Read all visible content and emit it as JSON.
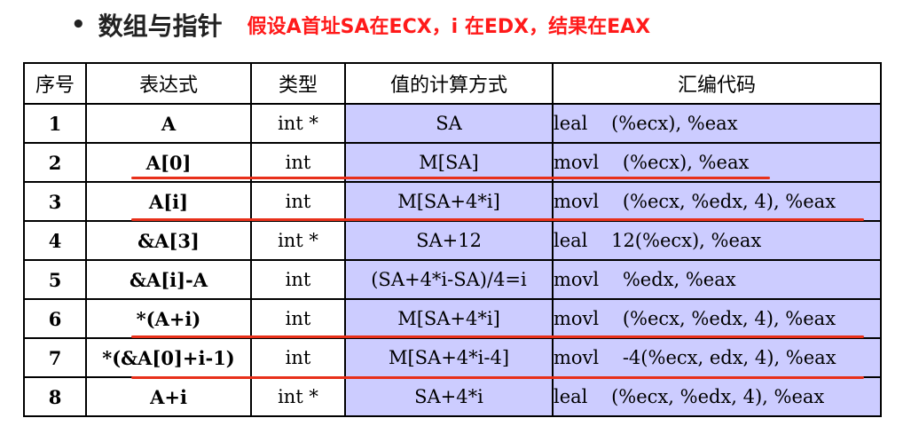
{
  "header": {
    "bullet": "•",
    "title": "数组与指针",
    "subtitle": "假设A首址SA在ECX，i 在EDX，结果在EAX"
  },
  "table": {
    "columns": [
      "序号",
      "表达式",
      "类型",
      "值的计算方式",
      "汇编代码"
    ],
    "rows": [
      {
        "idx": "1",
        "expr": "A",
        "type": "int *",
        "value": "SA",
        "asm": "leal    (%ecx), %eax"
      },
      {
        "idx": "2",
        "expr": "A[0]",
        "type": "int",
        "value": "M[SA]",
        "asm": "movl    (%ecx), %eax"
      },
      {
        "idx": "3",
        "expr": "A[i]",
        "type": "int",
        "value": "M[SA+4*i]",
        "asm": "movl    (%ecx, %edx, 4), %eax"
      },
      {
        "idx": "4",
        "expr": "&A[3]",
        "type": "int *",
        "value": "SA+12",
        "asm": "leal    12(%ecx), %eax"
      },
      {
        "idx": "5",
        "expr": "&A[i]-A",
        "type": "int",
        "value": "(SA+4*i-SA)/4=i",
        "asm": "movl    %edx, %eax"
      },
      {
        "idx": "6",
        "expr": "*(A+i)",
        "type": "int",
        "value": "M[SA+4*i]",
        "asm": "movl    (%ecx, %edx, 4), %eax"
      },
      {
        "idx": "7",
        "expr": "*(&A[0]+i-1)",
        "type": "int",
        "value": "M[SA+4*i-4]",
        "asm": "movl    -4(%ecx, edx, 4), %eax"
      },
      {
        "idx": "8",
        "expr": "A+i",
        "type": "int *",
        "value": "SA+4*i",
        "asm": "leal    (%ecx, %edx, 4), %eax"
      }
    ]
  },
  "colors": {
    "subtitle": "#ff1a1a",
    "highlight_bg": "#ccccff",
    "underline": "#e8301a"
  }
}
